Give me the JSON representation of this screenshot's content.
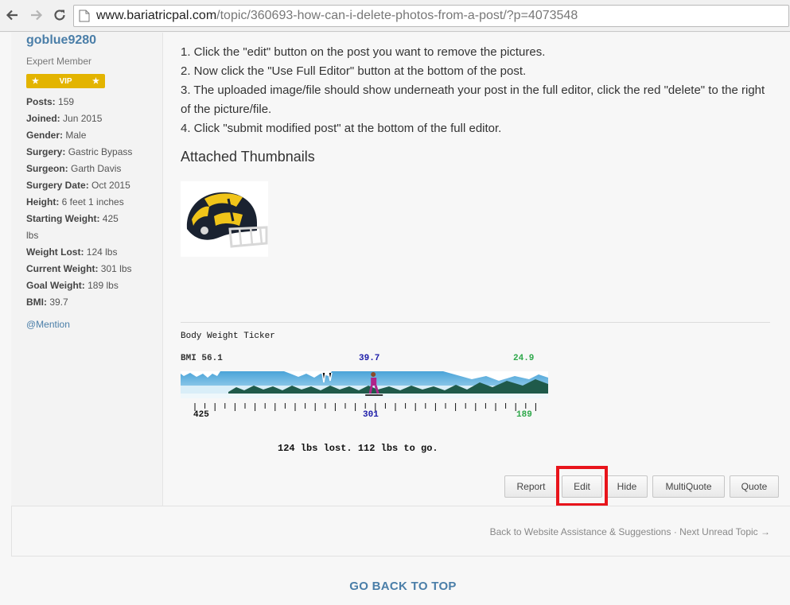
{
  "browser": {
    "url_host": "www.bariatricpal.com",
    "url_path": "/topic/360693-how-can-i-delete-photos-from-a-post/?p=4073548"
  },
  "profile": {
    "username": "goblue9280",
    "member_title": "Expert Member",
    "badge": "VIP",
    "stats": [
      {
        "label": "Posts:",
        "value": "159"
      },
      {
        "label": "Joined:",
        "value": "Jun 2015"
      },
      {
        "label": "Gender:",
        "value": "Male"
      },
      {
        "label": "Surgery:",
        "value": "Gastric Bypass"
      },
      {
        "label": "Surgeon:",
        "value": "Garth Davis"
      },
      {
        "label": "Surgery Date:",
        "value": "Oct 2015"
      },
      {
        "label": "Height:",
        "value": "6 feet 1 inches"
      },
      {
        "label": "Starting Weight:",
        "value": "425 lbs"
      },
      {
        "label": "Weight Lost:",
        "value": "124 lbs"
      },
      {
        "label": "Current Weight:",
        "value": "301 lbs"
      },
      {
        "label": "Goal Weight:",
        "value": "189 lbs"
      },
      {
        "label": "BMI:",
        "value": "39.7"
      }
    ],
    "mention": "@Mention"
  },
  "post": {
    "steps": [
      "1.  Click the \"edit\" button on the post you want to remove the pictures.",
      "2.  Now click the \"Use Full Editor\" button at the bottom of the post.",
      "3.  The uploaded image/file should show underneath your post in the full editor, click the red \"delete\" to the right of the picture/file.",
      "4.  Click \"submit modified post\" at the bottom of the full editor."
    ],
    "attachments_heading": "Attached Thumbnails"
  },
  "ticker": {
    "title": "Body Weight Ticker",
    "bmi_start": "BMI 56.1",
    "bmi_current": "39.7",
    "bmi_goal": "24.9",
    "weight_start": "425",
    "weight_current": "301",
    "weight_goal": "189",
    "progress_text": "124 lbs lost. 112 lbs to go.",
    "progress_fraction": 0.525,
    "colors": {
      "start": "#111111",
      "current": "#1a1aa8",
      "goal": "#2ea84a"
    }
  },
  "actions": {
    "report": "Report",
    "edit": "Edit",
    "hide": "Hide",
    "multiquote": "MultiQuote",
    "quote": "Quote"
  },
  "topic_nav": {
    "back": "Back to Website Assistance & Suggestions",
    "separator": "·",
    "next": "Next Unread Topic →"
  },
  "go_top": "GO BACK TO TOP",
  "colors": {
    "accent": "#4a7ea8",
    "badge": "#e3b400",
    "highlight": "#e8141b"
  }
}
